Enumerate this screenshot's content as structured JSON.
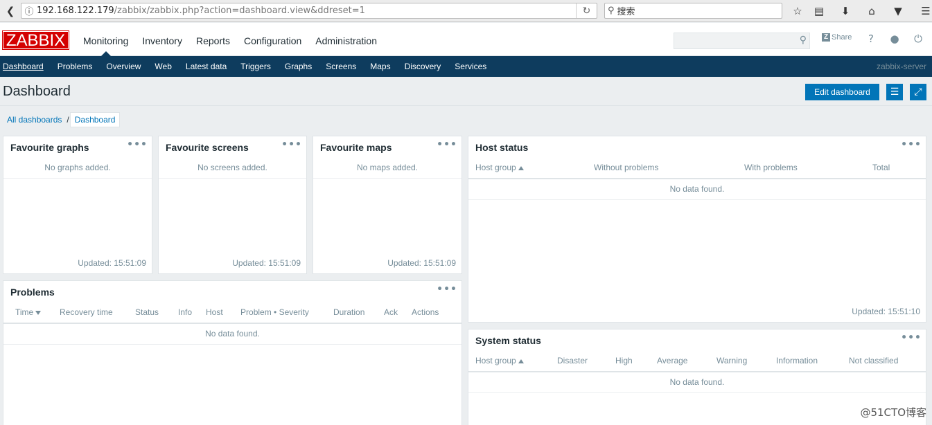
{
  "browser": {
    "url_host": "192.168.122.179",
    "url_path": "/zabbix/zabbix.php?action=dashboard.view&ddreset=1",
    "search_placeholder": "搜索"
  },
  "header": {
    "logo": "ZABBIX",
    "menu": [
      "Monitoring",
      "Inventory",
      "Reports",
      "Configuration",
      "Administration"
    ],
    "share_label": "Share",
    "help_label": "?"
  },
  "submenu": {
    "items": [
      "Dashboard",
      "Problems",
      "Overview",
      "Web",
      "Latest data",
      "Triggers",
      "Graphs",
      "Screens",
      "Maps",
      "Discovery",
      "Services"
    ],
    "server_name": "zabbix-server"
  },
  "page": {
    "title": "Dashboard",
    "edit_button": "Edit dashboard",
    "breadcrumb": [
      "All dashboards",
      "Dashboard"
    ],
    "breadcrumb_sep": "/"
  },
  "widgets": {
    "fav_graphs": {
      "title": "Favourite graphs",
      "message": "No graphs added.",
      "updated": "Updated: 15:51:09"
    },
    "fav_screens": {
      "title": "Favourite screens",
      "message": "No screens added.",
      "updated": "Updated: 15:51:09"
    },
    "fav_maps": {
      "title": "Favourite maps",
      "message": "No maps added.",
      "updated": "Updated: 15:51:09"
    },
    "host_status": {
      "title": "Host status",
      "columns": [
        "Host group",
        "Without problems",
        "With problems",
        "Total"
      ],
      "empty": "No data found.",
      "updated": "Updated: 15:51:10"
    },
    "problems": {
      "title": "Problems",
      "columns": [
        "Time",
        "Recovery time",
        "Status",
        "Info",
        "Host",
        "Problem • Severity",
        "Duration",
        "Ack",
        "Actions"
      ],
      "empty": "No data found."
    },
    "system_status": {
      "title": "System status",
      "columns": [
        "Host group",
        "Disaster",
        "High",
        "Average",
        "Warning",
        "Information",
        "Not classified"
      ],
      "empty": "No data found."
    },
    "menu_dots": "•••"
  },
  "watermark": "@51CTO博客"
}
